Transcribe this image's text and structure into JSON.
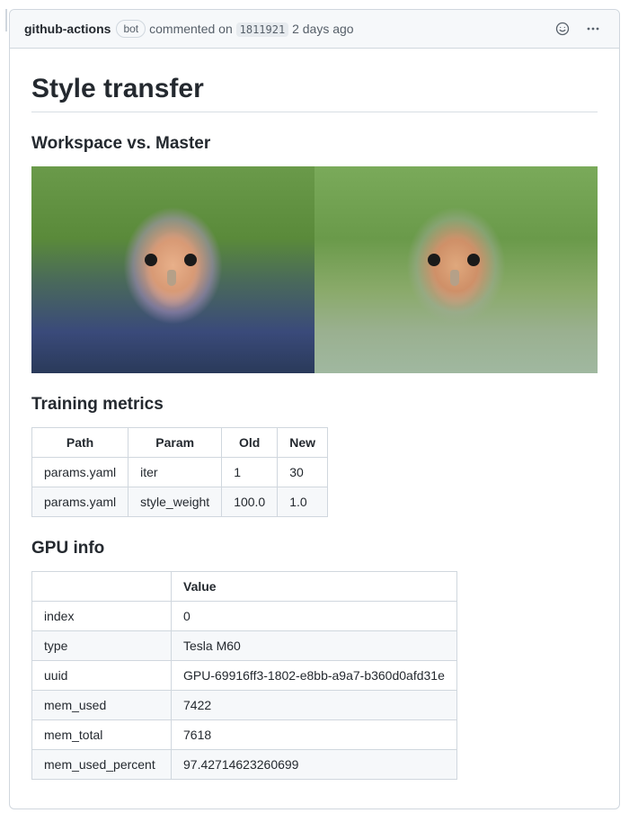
{
  "header": {
    "author": "github-actions",
    "bot_label": "bot",
    "commented_prefix": "commented on",
    "commit_sha": "1811921",
    "relative_time": "2 days ago"
  },
  "comment": {
    "title": "Style transfer",
    "section_compare": "Workspace vs. Master",
    "section_metrics": "Training metrics",
    "section_gpu": "GPU info"
  },
  "metrics_table": {
    "headers": [
      "Path",
      "Param",
      "Old",
      "New"
    ],
    "rows": [
      [
        "params.yaml",
        "iter",
        "1",
        "30"
      ],
      [
        "params.yaml",
        "style_weight",
        "100.0",
        "1.0"
      ]
    ]
  },
  "gpu_table": {
    "header_value": "Value",
    "rows": [
      [
        "index",
        "0"
      ],
      [
        "type",
        "Tesla M60"
      ],
      [
        "uuid",
        "GPU-69916ff3-1802-e8bb-a9a7-b360d0afd31e"
      ],
      [
        "mem_used",
        "7422"
      ],
      [
        "mem_total",
        "7618"
      ],
      [
        "mem_used_percent",
        "97.42714623260699"
      ]
    ]
  },
  "icons": {
    "emoji": "emoji-reaction-icon",
    "kebab": "kebab-menu-icon"
  }
}
